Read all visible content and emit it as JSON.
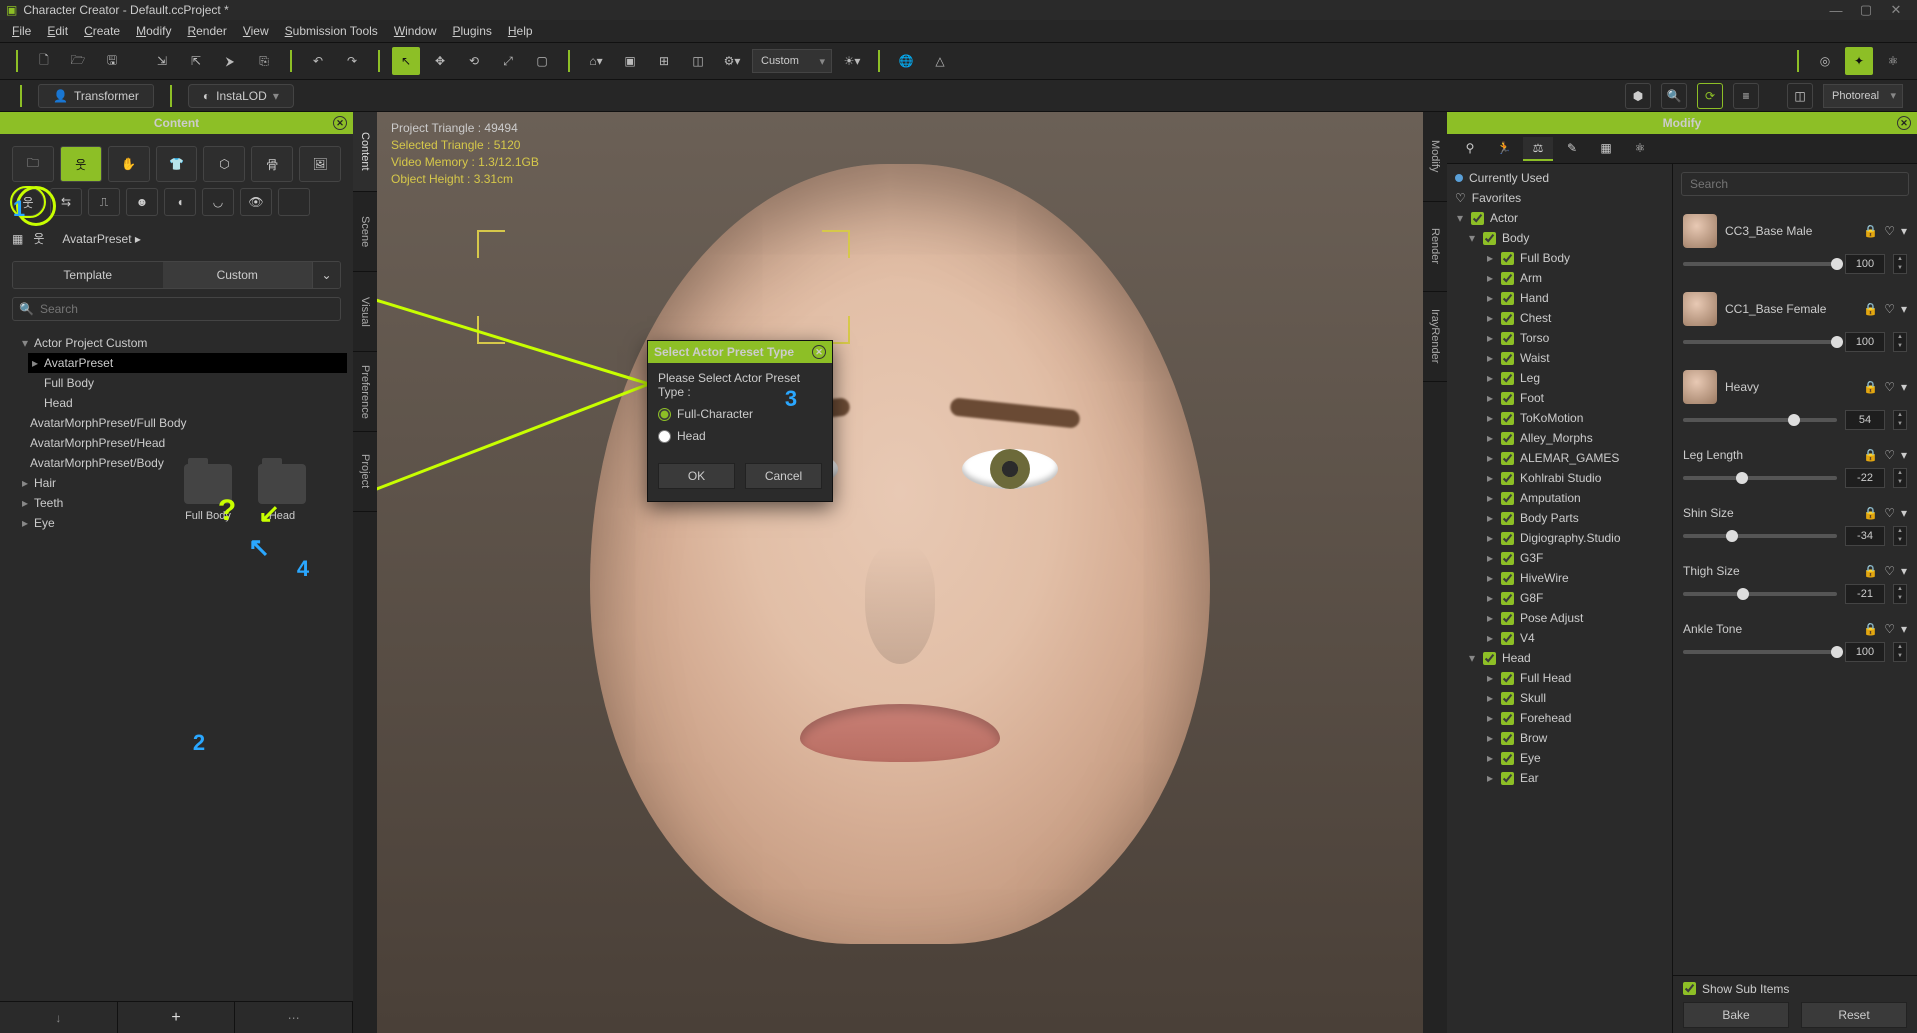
{
  "window": {
    "title": "Character Creator - Default.ccProject *"
  },
  "menu": [
    "File",
    "Edit",
    "Create",
    "Modify",
    "Render",
    "View",
    "Submission Tools",
    "Window",
    "Plugins",
    "Help"
  ],
  "toolbar": {
    "preset_dropdown": "Custom"
  },
  "subbar": {
    "transformer": "Transformer",
    "instalod": "InstaLOD",
    "photoreal": "Photoreal"
  },
  "content": {
    "title": "Content",
    "breadcrumb": "AvatarPreset ▸",
    "tabs": {
      "template": "Template",
      "custom": "Custom"
    },
    "search_placeholder": "Search",
    "tree": [
      "Actor Project Custom",
      "AvatarPreset",
      "Full Body",
      "Head",
      "AvatarMorphPreset/Full Body",
      "AvatarMorphPreset/Head",
      "AvatarMorphPreset/Body",
      "Hair",
      "Teeth",
      "Eye"
    ],
    "folders": [
      "Full Body",
      "Head"
    ]
  },
  "sidetabs_left": [
    "Content",
    "Scene",
    "Visual",
    "Preference",
    "Project"
  ],
  "viewport": {
    "stats": {
      "line1a": "Project Triangle :",
      "line1b": "49494",
      "line2": "Selected Triangle : 5120",
      "line3": "Video Memory : 1.3/12.1GB",
      "line4": "Object Height : 3.31cm"
    },
    "dialog": {
      "title": "Select Actor Preset Type",
      "prompt": "Please Select Actor Preset Type :",
      "opt1": "Full-Character",
      "opt2": "Head",
      "ok": "OK",
      "cancel": "Cancel"
    }
  },
  "annot": {
    "n1": "1",
    "n2": "2",
    "n3": "3",
    "n4": "4",
    "q": "?"
  },
  "sidetabs_right": [
    "Modify",
    "Render",
    "IrayRender"
  ],
  "modify": {
    "title": "Modify",
    "tree": {
      "currently_used": "Currently Used",
      "favorites": "Favorites",
      "actor": "Actor",
      "body": "Body",
      "body_items": [
        "Full Body",
        "Arm",
        "Hand",
        "Chest",
        "Torso",
        "Waist",
        "Leg",
        "Foot",
        "ToKoMotion",
        "Alley_Morphs",
        "ALEMAR_GAMES",
        "Kohlrabi Studio",
        "Amputation",
        "Body Parts",
        "Digiography.Studio",
        "G3F",
        "HiveWire",
        "G8F",
        "Pose Adjust",
        "V4"
      ],
      "head": "Head",
      "head_items": [
        "Full Head",
        "Skull",
        "Forehead",
        "Brow",
        "Eye",
        "Ear"
      ]
    },
    "search_placeholder": "Search",
    "sliders": [
      {
        "label": "CC3_Base Male",
        "value": "100",
        "knob": 100,
        "thumb": true
      },
      {
        "label": "CC1_Base Female",
        "value": "100",
        "knob": 100,
        "thumb": true
      },
      {
        "label": "Heavy",
        "value": "54",
        "knob": 72,
        "thumb": true
      },
      {
        "label": "Leg Length",
        "value": "-22",
        "knob": 38,
        "thumb": false
      },
      {
        "label": "Shin Size",
        "value": "-34",
        "knob": 32,
        "thumb": false
      },
      {
        "label": "Thigh Size",
        "value": "-21",
        "knob": 39,
        "thumb": false
      },
      {
        "label": "Ankle Tone",
        "value": "100",
        "knob": 100,
        "thumb": false
      }
    ],
    "show_sub": "Show Sub Items",
    "bake": "Bake",
    "reset": "Reset"
  }
}
